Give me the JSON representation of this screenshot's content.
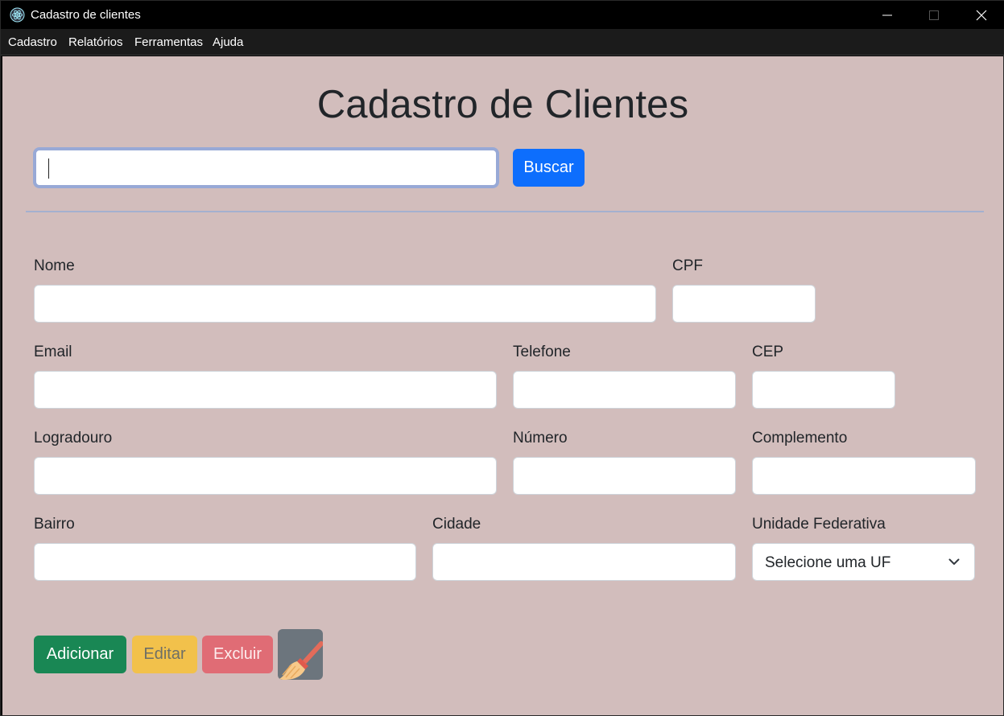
{
  "window": {
    "title": "Cadastro de clientes"
  },
  "menu": {
    "items": [
      "Cadastro",
      "Relatórios",
      "Ferramentas",
      "Ajuda"
    ]
  },
  "page": {
    "title": "Cadastro de Clientes"
  },
  "search": {
    "value": "",
    "button_label": "Buscar"
  },
  "form": {
    "fields": {
      "nome": {
        "label": "Nome",
        "value": ""
      },
      "cpf": {
        "label": "CPF",
        "value": ""
      },
      "email": {
        "label": "Email",
        "value": ""
      },
      "telefone": {
        "label": "Telefone",
        "value": ""
      },
      "cep": {
        "label": "CEP",
        "value": ""
      },
      "logradouro": {
        "label": "Logradouro",
        "value": ""
      },
      "numero": {
        "label": "Número",
        "value": ""
      },
      "complemento": {
        "label": "Complemento",
        "value": ""
      },
      "bairro": {
        "label": "Bairro",
        "value": ""
      },
      "cidade": {
        "label": "Cidade",
        "value": ""
      },
      "uf": {
        "label": "Unidade Federativa",
        "selected": "Selecione uma UF"
      }
    }
  },
  "actions": {
    "add": "Adicionar",
    "edit": "Editar",
    "delete": "Excluir",
    "clear_icon": "broom-icon"
  },
  "colors": {
    "background": "#d2bdbc",
    "primary": "#0d6efd",
    "success": "#198754",
    "warning": "#f2c14b",
    "danger": "#e06c75",
    "secondary": "#6c757d"
  }
}
